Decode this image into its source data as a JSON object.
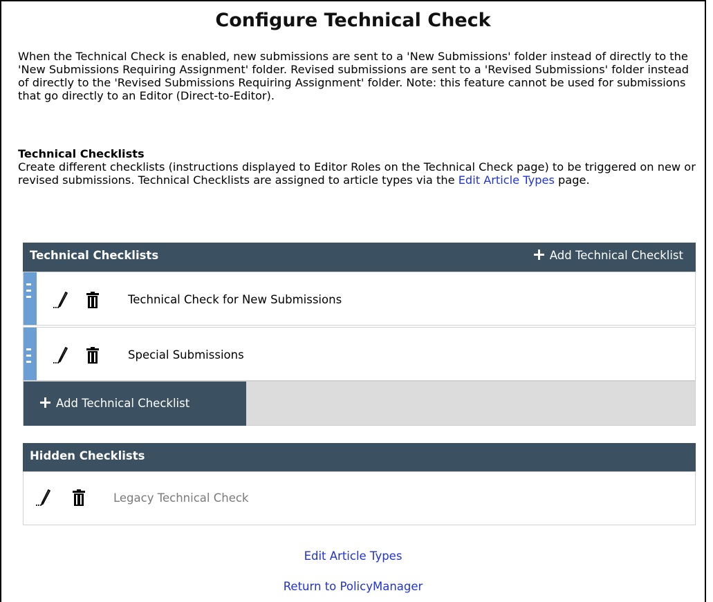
{
  "page": {
    "title": "Configure Technical Check",
    "intro": "When the Technical Check is enabled, new submissions are sent to a 'New Submissions' folder instead of directly to the 'New Submissions Requiring Assignment' folder. Revised submissions are sent to a 'Revised Submissions' folder instead of directly to the 'Revised Submissions Requiring Assignment' folder. Note: this feature cannot be used for submissions that go directly to an Editor (Direct-to-Editor).",
    "section_heading": "Technical Checklists",
    "section_desc_before": "Create different checklists (instructions displayed to Editor Roles on the Technical Check page) to be triggered on new or revised submissions. Technical Checklists are assigned to article types via the ",
    "section_desc_link": "Edit Article Types",
    "section_desc_after": " page."
  },
  "technical_panel": {
    "header": "Technical Checklists",
    "add_label": "Add Technical Checklist",
    "rows": [
      {
        "label": "Technical Check for New Submissions"
      },
      {
        "label": "Special Submissions"
      }
    ],
    "add_button_label": "Add Technical Checklist"
  },
  "hidden_panel": {
    "header": "Hidden Checklists",
    "rows": [
      {
        "label": "Legacy Technical Check"
      }
    ]
  },
  "footer": {
    "edit_article_types": "Edit Article Types",
    "return_policy_manager": "Return to PolicyManager"
  },
  "colors": {
    "header_bg": "#3b5060",
    "drag_handle": "#6b9fd4",
    "link": "#1f33d6",
    "hidden_text": "#7a7a7a"
  },
  "icons": {
    "edit": "pencil-icon",
    "delete": "trash-icon",
    "add": "plus-icon",
    "drag": "drag-handle-icon"
  }
}
